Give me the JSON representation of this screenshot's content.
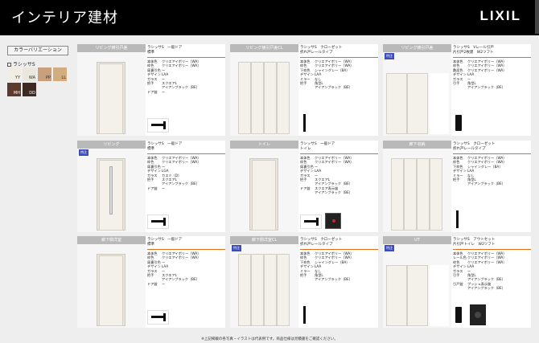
{
  "header": {
    "title": "インテリア建材",
    "brand": "LIXIL"
  },
  "sidebar": {
    "variation_button": "カラーバリエーション",
    "series_label": "ラシッサS",
    "swatches": [
      {
        "code": "YY",
        "color": "#f2ede2"
      },
      {
        "code": "WA",
        "color": "#ece7dc"
      },
      {
        "code": "PP",
        "color": "#c9a07b"
      },
      {
        "code": "LL",
        "color": "#d2ad7f"
      },
      {
        "code": "MH",
        "color": "#5d3a2b"
      },
      {
        "code": "DD",
        "color": "#3f2a23"
      }
    ]
  },
  "cards": [
    {
      "title": "リビング横引戸差",
      "name1": "ラシッサS　一般ドア",
      "name2": "標準",
      "specs": [
        [
          "本体色",
          "クリエアイボリー（WA）"
        ],
        [
          "枠色",
          "クリエアイボリー（WA）"
        ],
        [
          "扉裏引色",
          "ー"
        ],
        [
          "デザイン",
          "LAA"
        ],
        [
          "ガラス",
          "ー"
        ],
        [
          "把手",
          "スクエアL"
        ],
        [
          "",
          "アイアンブラック（BE）"
        ],
        [
          "ドア錠",
          "ー"
        ]
      ]
    },
    {
      "title": "リビング横引戸差CL",
      "name1": "ラシッサS　クローゼット",
      "name2": "折れ戸レールタイプ",
      "specs": [
        [
          "本体色",
          "クリエアイボリー（WA）"
        ],
        [
          "枠色",
          "クリエアイボリー（WA）"
        ],
        [
          "下枠色",
          "シャイングレー（BA）"
        ],
        [
          "デザイン",
          "LAA"
        ],
        [
          "ミラー",
          "なし"
        ],
        [
          "把手",
          "角型L"
        ],
        [
          "",
          "アイアンブラック（BE）"
        ]
      ]
    },
    {
      "title": "リビング横引戸差",
      "tag": "特注",
      "name1": "ラシッサS　Vレール引戸",
      "name2": "片引戸2枚建　W2ツフト",
      "specs": [
        [
          "本体色",
          "クリエアイボリー（WA）"
        ],
        [
          "枠色",
          "クリエアイボリー（WA）"
        ],
        [
          "敷居色",
          "クリエアイボリー（WA）"
        ],
        [
          "デザイン",
          "LAA"
        ],
        [
          "ガラス",
          "ー"
        ],
        [
          "引手",
          "角型L"
        ],
        [
          "",
          "アイアンブラック（BE）"
        ]
      ]
    },
    {
      "title": "リビング",
      "tag": "特注",
      "name1": "ラシッサS　一般ドア",
      "name2": "標準",
      "specs": [
        [
          "本体色",
          "クリエアイボリー（WA）"
        ],
        [
          "枠色",
          "クリエアイボリー（WA）"
        ],
        [
          "扉裏引色",
          "ー"
        ],
        [
          "デザイン",
          "LGA"
        ],
        [
          "ガラス",
          "カスミ（D）"
        ],
        [
          "把手",
          "スクエアL"
        ],
        [
          "",
          "アイアンブラック（BE）"
        ],
        [
          "ドア錠",
          "ー"
        ]
      ]
    },
    {
      "title": "トイレ",
      "name1": "ラシッサS　一般ドア",
      "name2": "トイレ",
      "specs": [
        [
          "本体色",
          "クリエアイボリー（WA）"
        ],
        [
          "枠色",
          "クリエアイボリー（WA）"
        ],
        [
          "扉裏引色",
          "ー"
        ],
        [
          "デザイン",
          "LAA"
        ],
        [
          "ガラス",
          "ー"
        ],
        [
          "把手",
          "スクエアL"
        ],
        [
          "",
          "アイアンブラック（BE）"
        ],
        [
          "ドア錠",
          "スクエア表示錠"
        ],
        [
          "",
          "アイアンブラック（BE）"
        ]
      ]
    },
    {
      "title": "廊下収納",
      "name1": "ラシッサS　クローゼット",
      "name2": "折れ戸レールタイプ",
      "specs": [
        [
          "本体色",
          "クリエアイボリー（WA）"
        ],
        [
          "枠色",
          "クリエアイボリー（WA）"
        ],
        [
          "下枠色",
          "シャイングレー（BA）"
        ],
        [
          "デザイン",
          "LAA"
        ],
        [
          "ミラー",
          "なし"
        ],
        [
          "把手",
          "角型L"
        ],
        [
          "",
          "アイアンブラック（BE）"
        ]
      ]
    },
    {
      "title": "廊下側洋室",
      "name1": "ラシッサS　一般ドア",
      "name2": "標準",
      "specs": [
        [
          "本体色",
          "クリエアイボリー（WA）"
        ],
        [
          "枠色",
          "クリエアイボリー（WA）"
        ],
        [
          "扉裏引色",
          "ー"
        ],
        [
          "デザイン",
          "LAA"
        ],
        [
          "ガラス",
          "ー"
        ],
        [
          "把手",
          "スクエアL"
        ],
        [
          "",
          "アイアンブラック（BE）"
        ],
        [
          "ドア錠",
          "ー"
        ]
      ]
    },
    {
      "title": "廊下側洋室CL",
      "tag": "特注",
      "name1": "ラシッサS　クローゼット",
      "name2": "折れ戸レールタイプ",
      "specs": [
        [
          "本体色",
          "クリエアイボリー（WA）"
        ],
        [
          "枠色",
          "クリエアイボリー（WA）"
        ],
        [
          "下枠色",
          "シャイングレー（BA）"
        ],
        [
          "デザイン",
          "LAA"
        ],
        [
          "ミラー",
          "なし"
        ],
        [
          "把手",
          "角型L"
        ],
        [
          "",
          "アイアンブラック（BE）"
        ]
      ]
    },
    {
      "title": "UT",
      "tag": "特注",
      "name1": "ラシッサS　アウトセット",
      "name2": "片引戸トイレ　W2ツフト",
      "specs": [
        [
          "本体色",
          "クリエアイボリー（WA）"
        ],
        [
          "レール色",
          "クリエアイボリー（WA）"
        ],
        [
          "枠色",
          "クリエアイボリー（WA）"
        ],
        [
          "デザイン",
          "LAA"
        ],
        [
          "ガラス",
          "ー"
        ],
        [
          "引手",
          "角型L"
        ],
        [
          "",
          "アイアンブラック（BE）"
        ],
        [
          "引戸錠",
          "プッシュ表示錠"
        ],
        [
          "",
          "アイアンブラック（BE）"
        ]
      ]
    }
  ],
  "footer": "※上記掲載の各写真・イラストは代表例です。商品仕様は見積書をご確認ください。"
}
